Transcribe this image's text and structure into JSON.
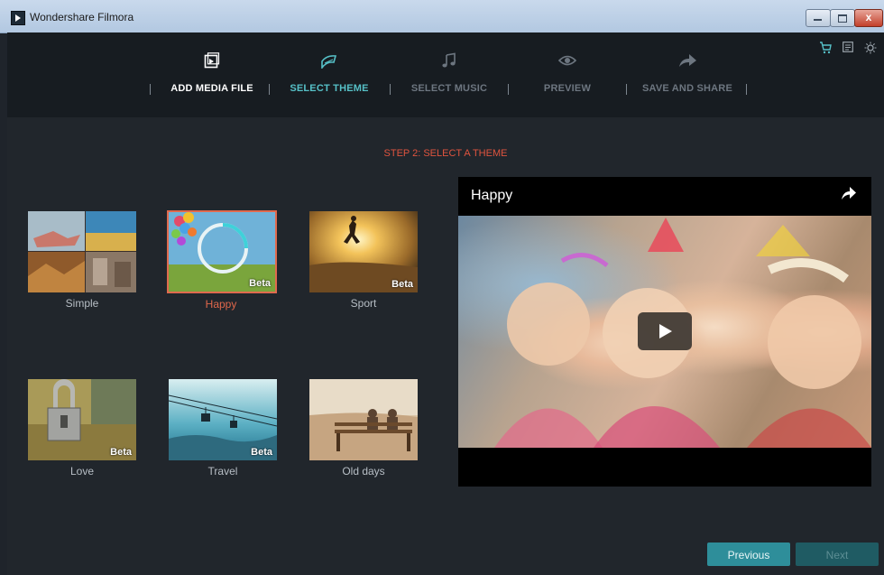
{
  "window": {
    "title": "Wondershare Filmora",
    "close_glyph": "x"
  },
  "nav": {
    "steps": [
      {
        "label": "ADD MEDIA FILE",
        "icon": "media-file-icon",
        "state": "done"
      },
      {
        "label": "SELECT THEME",
        "icon": "theme-icon",
        "state": "active"
      },
      {
        "label": "SELECT MUSIC",
        "icon": "music-note-icon",
        "state": "pending"
      },
      {
        "label": "PREVIEW",
        "icon": "eye-icon",
        "state": "pending"
      },
      {
        "label": "SAVE AND SHARE",
        "icon": "share-arrow-icon",
        "state": "pending"
      }
    ],
    "top_icons": [
      "cart-icon",
      "list-icon",
      "brightness-icon"
    ]
  },
  "colors": {
    "active": "#56c0c7",
    "done": "#ffffff",
    "pending": "#6d7680",
    "heading": "#e0543f",
    "selected": "#e0674b"
  },
  "main": {
    "heading": "STEP 2: SELECT A THEME",
    "themes": [
      {
        "name": "Simple",
        "beta": "",
        "selected": false
      },
      {
        "name": "Happy",
        "beta": "Beta",
        "selected": true
      },
      {
        "name": "Sport",
        "beta": "Beta",
        "selected": false
      },
      {
        "name": "Love",
        "beta": "Beta",
        "selected": false
      },
      {
        "name": "Travel",
        "beta": "Beta",
        "selected": false
      },
      {
        "name": "Old days",
        "beta": "",
        "selected": false
      }
    ]
  },
  "preview": {
    "title": "Happy"
  },
  "footer": {
    "previous": "Previous",
    "next": "Next"
  }
}
